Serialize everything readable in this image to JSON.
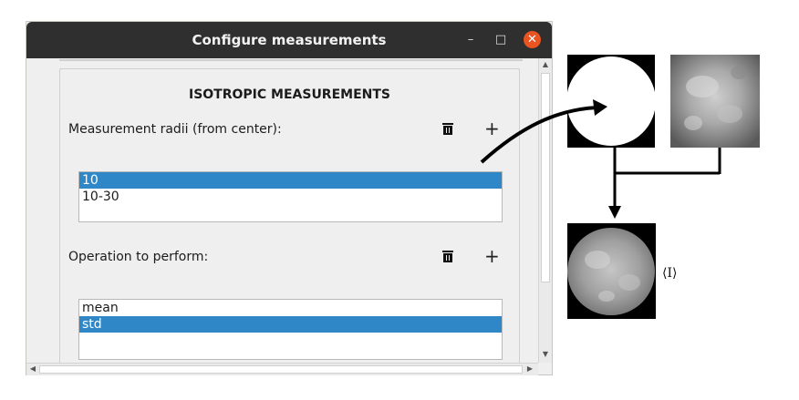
{
  "window": {
    "title": "Configure measurements",
    "minimize_glyph": "–",
    "maximize_glyph": "□",
    "close_glyph": "✕"
  },
  "section": {
    "heading": "ISOTROPIC MEASUREMENTS"
  },
  "radii": {
    "label": "Measurement radii (from center):",
    "items": [
      {
        "text": "10",
        "selected": true
      },
      {
        "text": "10-30",
        "selected": false
      }
    ],
    "add_glyph": "+"
  },
  "operation": {
    "label": "Operation to perform:",
    "items": [
      {
        "text": "mean",
        "selected": false
      },
      {
        "text": "std",
        "selected": true
      }
    ],
    "add_glyph": "+"
  },
  "figure": {
    "result_label": "⟨I⟩"
  },
  "colors": {
    "titlebar": "#2f2f2f",
    "selection": "#2f87c8",
    "close_button": "#e95420"
  }
}
